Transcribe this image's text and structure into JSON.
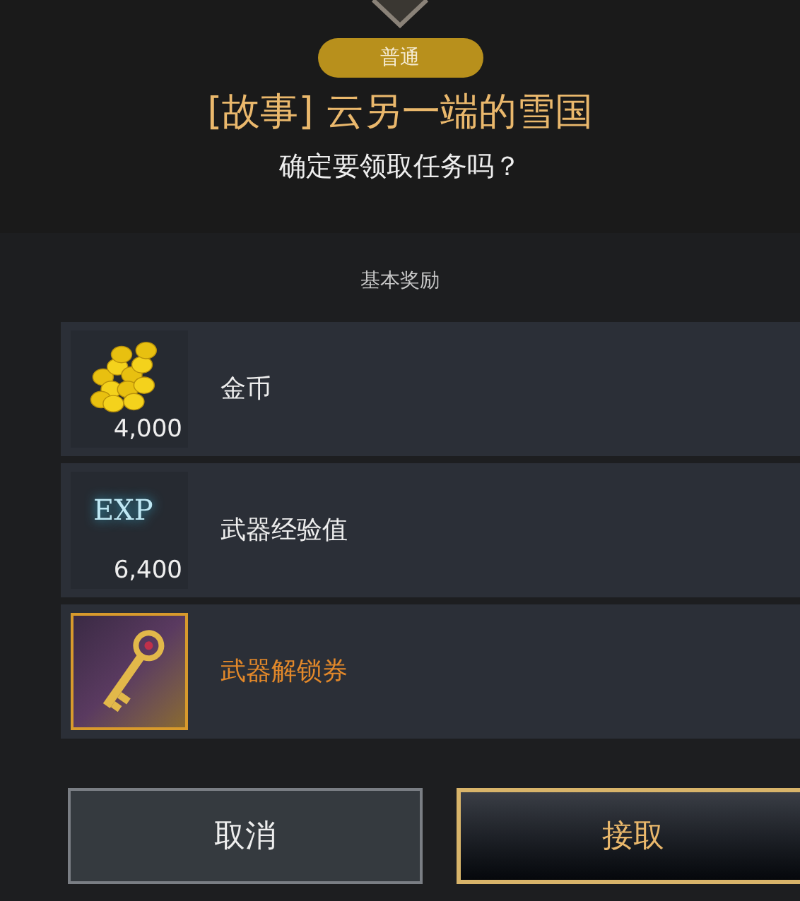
{
  "header": {
    "badge": "普通",
    "title": "[故事] 云另一端的雪国",
    "question": "确定要领取任务吗？"
  },
  "rewards": {
    "heading": "基本奖励",
    "items": [
      {
        "kind": "coins",
        "name": "金币",
        "amount": "4,000",
        "highlighted": false
      },
      {
        "kind": "exp",
        "icon_text": "EXP",
        "name": "武器经验值",
        "amount": "6,400",
        "highlighted": false
      },
      {
        "kind": "key",
        "name": "武器解锁券",
        "highlighted": true
      }
    ]
  },
  "buttons": [
    {
      "kind": "secondary",
      "label": "取消"
    },
    {
      "kind": "primary",
      "label": "接取"
    }
  ]
}
